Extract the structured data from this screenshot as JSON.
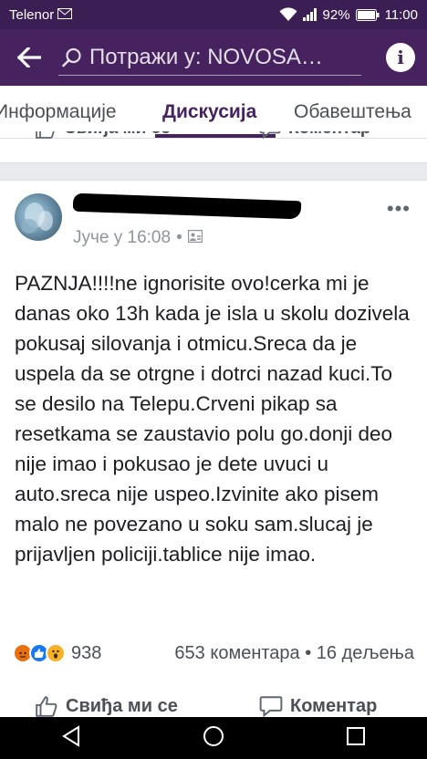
{
  "status_bar": {
    "carrier": "Telenor",
    "battery": "92%",
    "time": "11:00"
  },
  "app_bar": {
    "search_text": "Потражи у: NOVOSA…"
  },
  "tabs": [
    {
      "label": "Информације",
      "active": false
    },
    {
      "label": "Дискусија",
      "active": true
    },
    {
      "label": "Обавештења",
      "active": false
    }
  ],
  "previous_post_actions": {
    "like_label": "Свиђа ми се",
    "comment_label": "Коментар"
  },
  "post": {
    "author_name": "",
    "timestamp": "Јуче у 16:08",
    "privacy_icon": "group-icon",
    "more_label": "•••",
    "text": "PAZNJA!!!!ne ignorisite ovo!cerka mi je danas oko 13h kada je isla u skolu dozivela pokusaj silovanja i otmicu.Sreca da je uspela da se otrgne i dotrci nazad kuci.To se desilo na Telepu.Crveni pikap sa resetkama se zaustavio polu go.donji deo nije imao i pokusao je dete uvuci u auto.sreca nije uspeo.Izvinite ako pisem malo ne povezano u soku sam.slucaj je prijavljen policiji.tablice nije imao.",
    "reactions": [
      "angry",
      "like",
      "wow"
    ],
    "reaction_count": "938",
    "comments_shares": "653 коментара • 16 дељења",
    "like_label": "Свиђа ми се",
    "comment_label": "Коментар"
  },
  "colors": {
    "app_bar": "#46225f",
    "status_bar": "#3b1e54",
    "accent": "#46225f"
  }
}
